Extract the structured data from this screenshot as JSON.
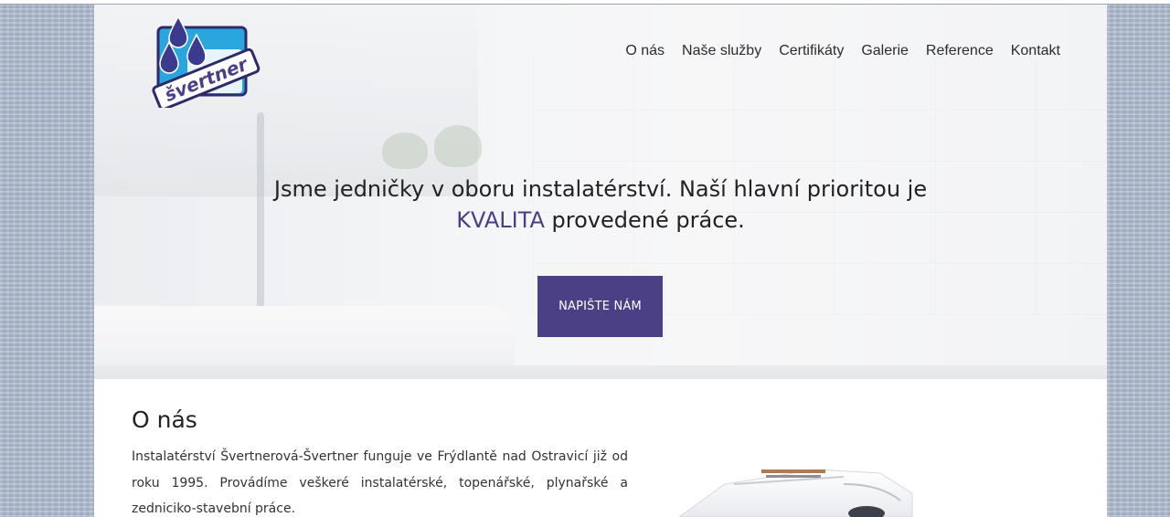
{
  "brand": {
    "logo_text": "Švertner",
    "accent_color": "#4b3f86"
  },
  "nav": {
    "items": [
      {
        "label": "O nás"
      },
      {
        "label": "Naše služby"
      },
      {
        "label": "Certifikáty"
      },
      {
        "label": "Galerie"
      },
      {
        "label": "Reference"
      },
      {
        "label": "Kontakt"
      }
    ]
  },
  "hero": {
    "line1": "Jsme jedničky v oboru instalatérství. Naší hlavní prioritou je",
    "accent_word": "KVALITA",
    "line2_rest": " provedené práce.",
    "cta_label": "NAPIŠTE NÁM"
  },
  "about": {
    "title": "O nás",
    "text": "Instalatérství Švertnerová-Švertner funguje ve Frýdlantě nad Ostravicí již od roku 1995. Provádíme veškeré instalatérské, topenářské, plynařské a zedniciko-stavební práce."
  }
}
